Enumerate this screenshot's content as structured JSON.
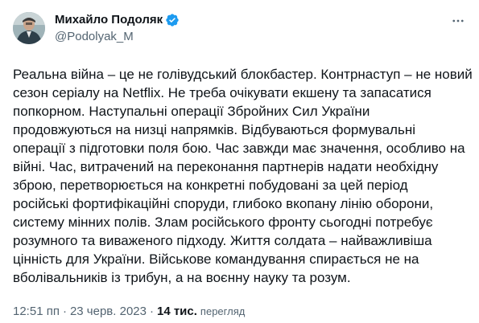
{
  "author": {
    "display_name": "Михайло Подоляк",
    "handle": "@Podolyak_M",
    "verified_color": "#1d9bf0"
  },
  "tweet": {
    "lines": [
      "Реальна війна – це не голівудський блокбастер. Контрнаступ – не новий",
      "сезон серіалу на Netflix. Не треба очікувати екшену та запасатися",
      "попкорном. Наступальні операції Збройних Сил України",
      "продовжуються на низці напрямків. Відбуваються формувальні",
      "операції з підготовки поля бою. Час завжди має значення, особливо на",
      "війні. Час, витрачений на переконання партнерів надати необхідну",
      "зброю, перетворюється на конкретні побудовані за цей період",
      "російські фортифікаційні споруди, глибоко вкопану лінію оборони,",
      "систему мінних полів. Злам російського фронту сьогодні потребує",
      "розумного та виваженого підходу. Життя солдата – найважливіша",
      "цінність для України. Військове командування спирається не на",
      "вболівальників із трибун, а на воєнну науку та розум."
    ]
  },
  "meta": {
    "time": "12:51 пп",
    "separator": "·",
    "date": "23 черв. 2023",
    "views_count": "14 тис.",
    "views_label": "перегляд"
  },
  "icons": {
    "more": "more-icon",
    "verified": "verified-badge-icon"
  }
}
